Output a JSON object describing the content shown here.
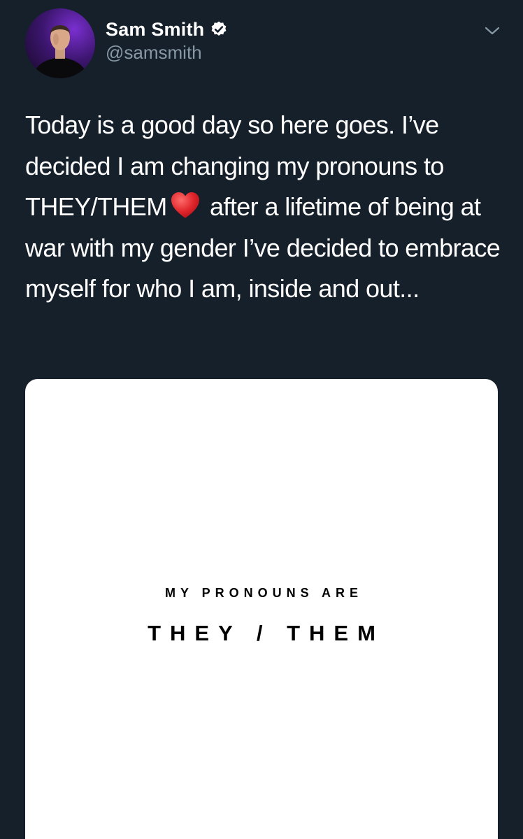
{
  "author": {
    "display_name": "Sam Smith",
    "handle": "@samsmith",
    "verified": true,
    "avatar_icon": "profile-photo"
  },
  "menu": {
    "icon": "chevron-down-icon"
  },
  "tweet": {
    "text_before_emoji": "Today is a good day so here goes. I’ve decided I am changing my pronouns to THEY/THEM",
    "emoji": "red-heart",
    "text_after_emoji": " after a lifetime of being at war with my gender I’ve decided to embrace myself for who I am, inside and out..."
  },
  "media": {
    "subtitle": "MY PRONOUNS ARE",
    "title": "THEY / THEM",
    "background": "#ffffff",
    "text_color": "#000000"
  },
  "colors": {
    "background": "#15202b",
    "secondary_text": "#8899a6",
    "verified_badge": "#ffffff"
  }
}
